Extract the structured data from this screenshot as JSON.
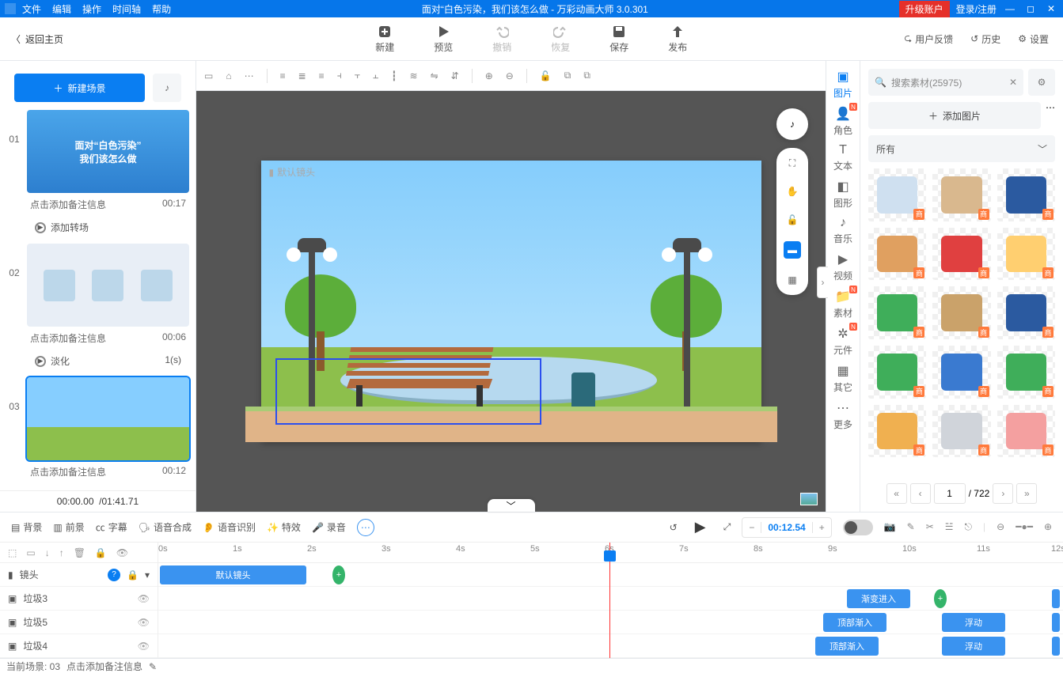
{
  "menus": [
    "文件",
    "编辑",
    "操作",
    "时间轴",
    "帮助"
  ],
  "title": "面对“白色污染，我们该怎么做 - 万彩动画大师 3.0.301",
  "upgrade": "升级账户",
  "login": "登录/注册",
  "back": "返回主页",
  "ops": [
    {
      "id": "new",
      "label": "新建",
      "dis": false
    },
    {
      "id": "preview",
      "label": "预览",
      "dis": false
    },
    {
      "id": "undo",
      "label": "撤销",
      "dis": true
    },
    {
      "id": "redo",
      "label": "恢复",
      "dis": true
    },
    {
      "id": "save",
      "label": "保存",
      "dis": false
    },
    {
      "id": "publish",
      "label": "发布",
      "dis": false
    }
  ],
  "rlinks": [
    "用户反馈",
    "历史",
    "设置"
  ],
  "newScene": "新建场景",
  "scenes": [
    {
      "num": "01",
      "note": "点击添加备注信息",
      "dur": "00:17",
      "trans": "添加转场",
      "transArg": "",
      "th": "th1",
      "l1": "面对“白色污染”",
      "l2": "我们该怎么做"
    },
    {
      "num": "02",
      "note": "点击添加备注信息",
      "dur": "00:06",
      "trans": "淡化",
      "transArg": "1(s)",
      "th": "th2"
    },
    {
      "num": "03",
      "note": "点击添加备注信息",
      "dur": "00:12",
      "trans": "",
      "transArg": "",
      "th": "th3",
      "sel": true
    }
  ],
  "sceneTime": {
    "cur": "00:00.00",
    "tot": "/01:41.71"
  },
  "camLabel": "默认镜头",
  "sidetabs": [
    {
      "id": "image",
      "label": "图片",
      "act": true,
      "new": false,
      "glyph": "▣"
    },
    {
      "id": "role",
      "label": "角色",
      "new": true,
      "glyph": "👤"
    },
    {
      "id": "text",
      "label": "文本",
      "new": false,
      "glyph": "T"
    },
    {
      "id": "shape",
      "label": "图形",
      "new": false,
      "glyph": "◧"
    },
    {
      "id": "music",
      "label": "音乐",
      "new": false,
      "glyph": "♪"
    },
    {
      "id": "video",
      "label": "视频",
      "new": false,
      "glyph": "▶"
    },
    {
      "id": "asset",
      "label": "素材",
      "new": true,
      "glyph": "📁"
    },
    {
      "id": "symbol",
      "label": "元件",
      "new": true,
      "glyph": "✲"
    },
    {
      "id": "other",
      "label": "其它",
      "new": false,
      "glyph": "▦"
    },
    {
      "id": "more",
      "label": "更多",
      "new": false,
      "glyph": "⋯"
    }
  ],
  "search": {
    "placeholder": "搜索素材(25975)"
  },
  "addImage": "添加图片",
  "category": "所有",
  "badge": "商",
  "pager": {
    "page": "1",
    "total": "/ 722"
  },
  "tlHead": [
    "背景",
    "前景",
    "字幕",
    "语音合成",
    "语音识别",
    "特效",
    "录音"
  ],
  "tlTime": "00:12.54",
  "tracks": {
    "lens": "镜头",
    "rows": [
      "垃圾3",
      "垃圾5",
      "垃圾4"
    ]
  },
  "clips": {
    "lens": "默认镜头",
    "a": "渐变进入",
    "b": "顶部渐入",
    "c": "浮动"
  },
  "ruler": [
    "0s",
    "1s",
    "2s",
    "3s",
    "4s",
    "5s",
    "6s",
    "7s",
    "8s",
    "9s",
    "10s",
    "11s",
    "12s"
  ],
  "status": {
    "scene": "当前场景: 03",
    "note": "点击添加备注信息"
  }
}
